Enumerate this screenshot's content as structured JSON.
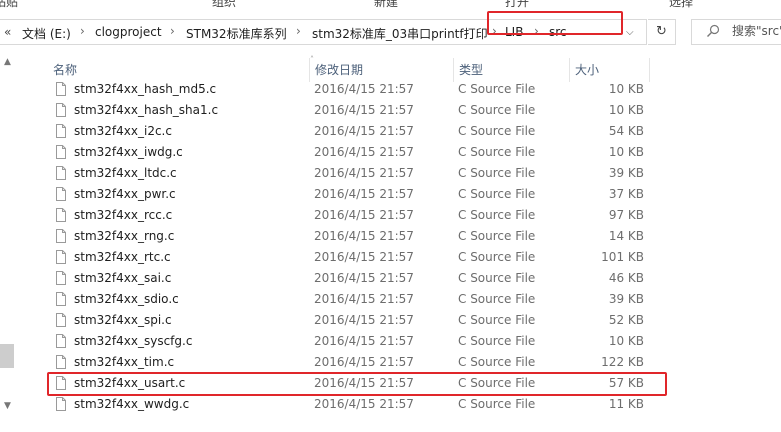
{
  "ribbon": {
    "labels": [
      "粘贴",
      "组织",
      "新建",
      "打开",
      "选择"
    ]
  },
  "address": {
    "overflow": "«",
    "crumbs": [
      "文档 (E:)",
      "clogproject",
      "STM32标准库系列",
      "stm32标准库_03串口printf打印",
      "LIB",
      "src"
    ],
    "separator": "›",
    "dropdown": "⌵",
    "refresh": "↻"
  },
  "search": {
    "placeholder": "搜索\"src\""
  },
  "columns": {
    "name": "名称",
    "date": "修改日期",
    "type": "类型",
    "size": "大小"
  },
  "files": [
    {
      "name": "stm32f4xx_hash_md5.c",
      "date": "2016/4/15 21:57",
      "type": "C Source File",
      "size": "10 KB"
    },
    {
      "name": "stm32f4xx_hash_sha1.c",
      "date": "2016/4/15 21:57",
      "type": "C Source File",
      "size": "10 KB"
    },
    {
      "name": "stm32f4xx_i2c.c",
      "date": "2016/4/15 21:57",
      "type": "C Source File",
      "size": "54 KB"
    },
    {
      "name": "stm32f4xx_iwdg.c",
      "date": "2016/4/15 21:57",
      "type": "C Source File",
      "size": "10 KB"
    },
    {
      "name": "stm32f4xx_ltdc.c",
      "date": "2016/4/15 21:57",
      "type": "C Source File",
      "size": "39 KB"
    },
    {
      "name": "stm32f4xx_pwr.c",
      "date": "2016/4/15 21:57",
      "type": "C Source File",
      "size": "37 KB"
    },
    {
      "name": "stm32f4xx_rcc.c",
      "date": "2016/4/15 21:57",
      "type": "C Source File",
      "size": "97 KB"
    },
    {
      "name": "stm32f4xx_rng.c",
      "date": "2016/4/15 21:57",
      "type": "C Source File",
      "size": "14 KB"
    },
    {
      "name": "stm32f4xx_rtc.c",
      "date": "2016/4/15 21:57",
      "type": "C Source File",
      "size": "101 KB"
    },
    {
      "name": "stm32f4xx_sai.c",
      "date": "2016/4/15 21:57",
      "type": "C Source File",
      "size": "46 KB"
    },
    {
      "name": "stm32f4xx_sdio.c",
      "date": "2016/4/15 21:57",
      "type": "C Source File",
      "size": "39 KB"
    },
    {
      "name": "stm32f4xx_spi.c",
      "date": "2016/4/15 21:57",
      "type": "C Source File",
      "size": "52 KB"
    },
    {
      "name": "stm32f4xx_syscfg.c",
      "date": "2016/4/15 21:57",
      "type": "C Source File",
      "size": "10 KB"
    },
    {
      "name": "stm32f4xx_tim.c",
      "date": "2016/4/15 21:57",
      "type": "C Source File",
      "size": "122 KB"
    },
    {
      "name": "stm32f4xx_usart.c",
      "date": "2016/4/15 21:57",
      "type": "C Source File",
      "size": "57 KB"
    },
    {
      "name": "stm32f4xx_wwdg.c",
      "date": "2016/4/15 21:57",
      "type": "C Source File",
      "size": "11 KB"
    }
  ],
  "colors": {
    "highlight": "#e0262a",
    "header_text": "#4c607a"
  },
  "icons": {
    "file": "file-icon",
    "search": "search-icon",
    "refresh": "refresh-icon"
  }
}
